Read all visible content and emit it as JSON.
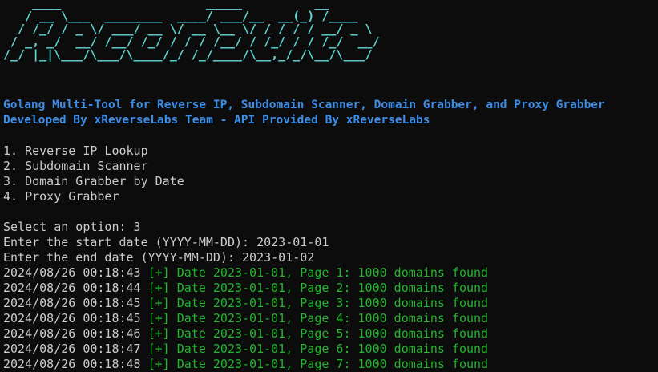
{
  "banner": {
    "ascii": "    ____                    _____          __\n   / __ \\___  ________  ____/ ___/__  __(_) /____\n  / /_/ / _ \\/ ___/ __ \\/ __ \\__ \\/ / / / / __/ _ \\\n / _, _/  __/ /__/ /_/ / / / /__/ / /_/ / / /_/  __/\n/_/ |_|\\___/\\___/\\____/_/ /_/____/\\__,_/_/\\__/\\___/",
    "color": "#61d6d6"
  },
  "info": {
    "line1": "Golang Multi-Tool for Reverse IP, Subdomain Scanner, Domain Grabber, and Proxy Grabber",
    "line2": "Developed By xReverseLabs Team - API Provided By xReverseLabs",
    "color": "#3b8eea"
  },
  "menu": {
    "items": [
      "1. Reverse IP Lookup",
      "2. Subdomain Scanner",
      "3. Domain Grabber by Date",
      "4. Proxy Grabber"
    ]
  },
  "inputs": {
    "select_prompt": "Select an option: 3",
    "start_prompt": "Enter the start date (YYYY-MM-DD): 2023-01-01",
    "end_prompt": "Enter the end date (YYYY-MM-DD): 2023-01-02"
  },
  "log": {
    "success_color": "#23b52e",
    "entries": [
      {
        "ts": "2024/08/26 00:18:43",
        "msg": "[+] Date 2023-01-01, Page 1: 1000 domains found"
      },
      {
        "ts": "2024/08/26 00:18:44",
        "msg": "[+] Date 2023-01-01, Page 2: 1000 domains found"
      },
      {
        "ts": "2024/08/26 00:18:45",
        "msg": "[+] Date 2023-01-01, Page 3: 1000 domains found"
      },
      {
        "ts": "2024/08/26 00:18:45",
        "msg": "[+] Date 2023-01-01, Page 4: 1000 domains found"
      },
      {
        "ts": "2024/08/26 00:18:46",
        "msg": "[+] Date 2023-01-01, Page 5: 1000 domains found"
      },
      {
        "ts": "2024/08/26 00:18:47",
        "msg": "[+] Date 2023-01-01, Page 6: 1000 domains found"
      },
      {
        "ts": "2024/08/26 00:18:48",
        "msg": "[+] Date 2023-01-01, Page 7: 1000 domains found"
      }
    ]
  }
}
